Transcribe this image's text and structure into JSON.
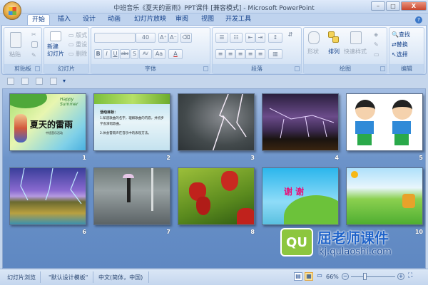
{
  "window": {
    "title": "中班音乐《夏天的雷雨》PPT课件 [兼容模式] - Microsoft PowerPoint",
    "minimize": "–",
    "maximize": "□",
    "close": "X"
  },
  "tabs": [
    {
      "label": "开始",
      "active": true
    },
    {
      "label": "插入"
    },
    {
      "label": "设计"
    },
    {
      "label": "动画"
    },
    {
      "label": "幻灯片放映"
    },
    {
      "label": "审阅"
    },
    {
      "label": "视图"
    },
    {
      "label": "开发工具"
    }
  ],
  "ribbon": {
    "clipboard": {
      "label": "剪贴板",
      "paste": "粘贴"
    },
    "slides": {
      "label": "幻灯片",
      "new_slide": "新建\n幻灯片",
      "layout": "版式",
      "reset": "重设",
      "delete": "删除"
    },
    "font": {
      "label": "字体",
      "font_name": "",
      "font_size": "40",
      "bold": "B",
      "italic": "I",
      "underline": "U",
      "strike": "abc",
      "shadow": "S",
      "spacing": "AV",
      "case": "Aa",
      "color": "A",
      "grow": "A⁺",
      "shrink": "A⁻"
    },
    "paragraph": {
      "label": "段落"
    },
    "drawing": {
      "label": "绘图",
      "shapes": "形状",
      "arrange": "排列",
      "quick_styles": "快速样式"
    },
    "editing": {
      "label": "编辑",
      "find": "查找",
      "replace": "替换",
      "select": "选择"
    }
  },
  "slides": [
    {
      "number": "1",
      "title": "夏天的雷雨",
      "subtitle": "中班音乐活动",
      "caption": "Happy Summer"
    },
    {
      "number": "2",
      "heading": "活动目标：",
      "line1": "1.知道歌曲的名字，理解歌曲的内容，并初步学会演唱歌曲。",
      "line2": "2.体会雷雨声在音乐中的表现方法。"
    },
    {
      "number": "3"
    },
    {
      "number": "4"
    },
    {
      "number": "5"
    },
    {
      "number": "6"
    },
    {
      "number": "7"
    },
    {
      "number": "8"
    },
    {
      "number": "9",
      "title": "谢 谢"
    },
    {
      "number": "10"
    }
  ],
  "status": {
    "view": "幻灯片浏览",
    "theme": "\"默认设计模板\"",
    "language": "中文(简体，中国)",
    "zoom": "66%",
    "zoom_percent": 66
  },
  "watermark": {
    "brand": "屈老师课件",
    "url": "kj.qulaoshi.com",
    "logo": "QU"
  }
}
